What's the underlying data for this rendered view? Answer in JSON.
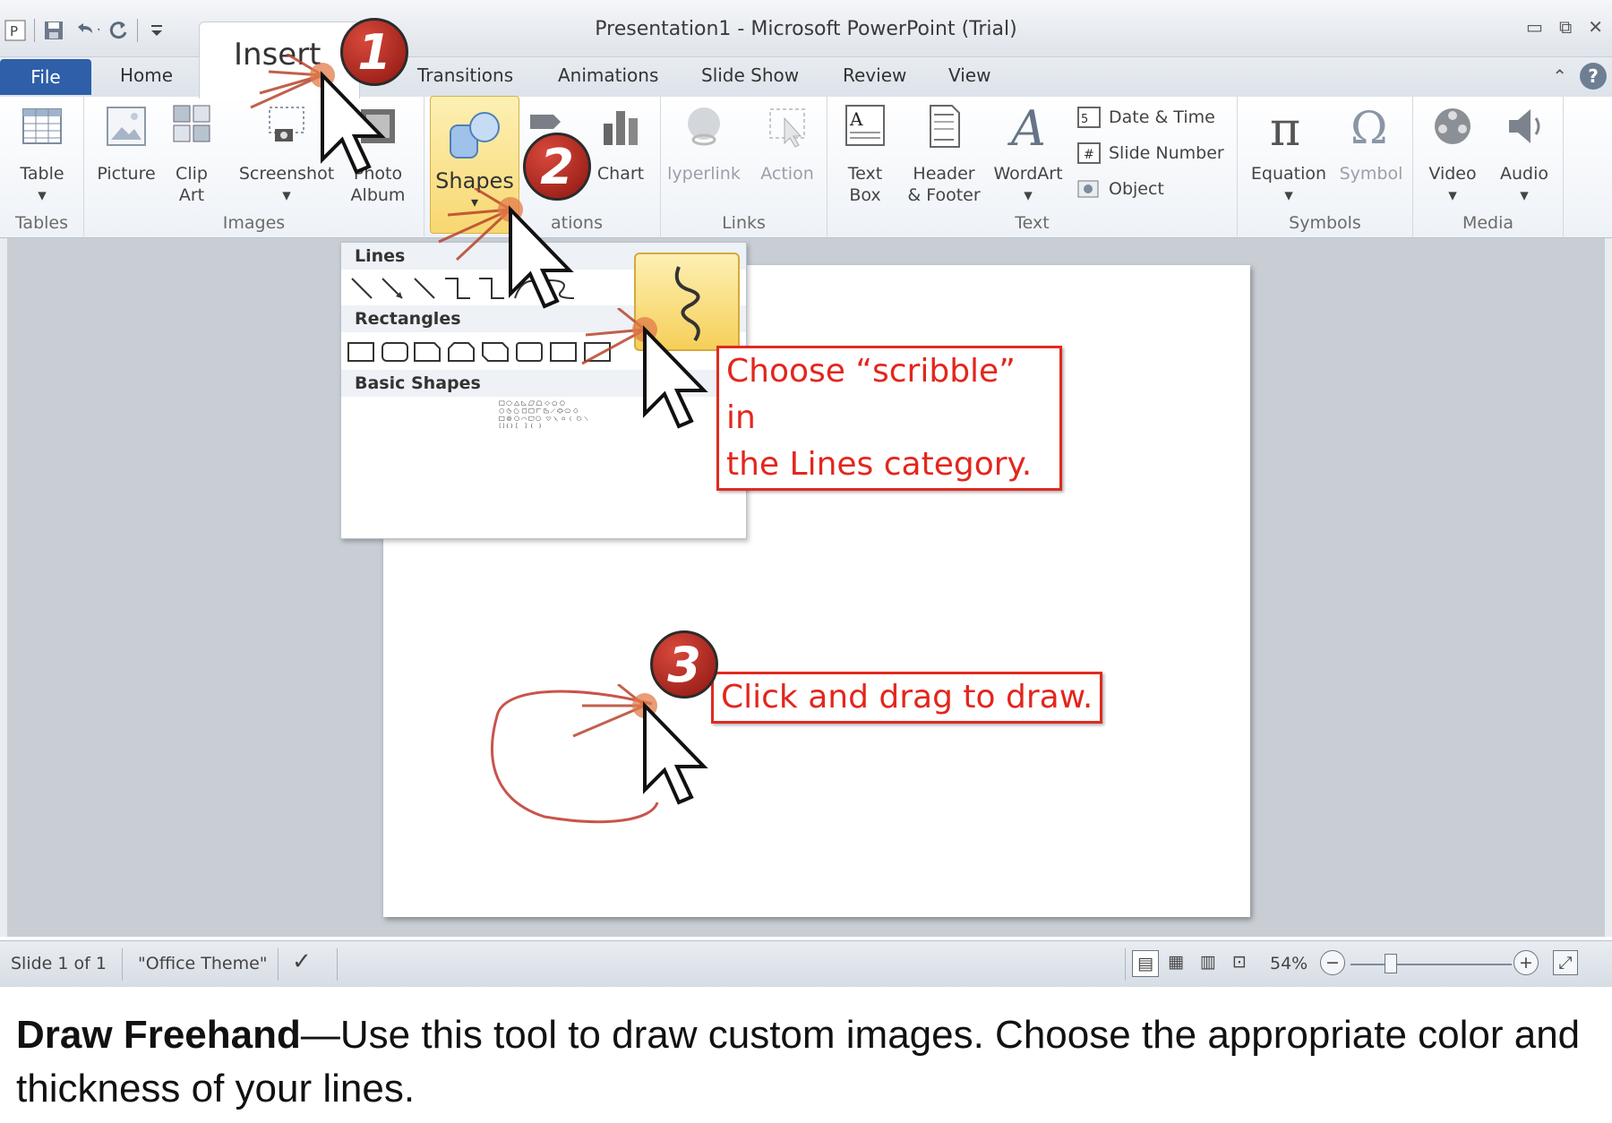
{
  "window": {
    "title": "Presentation1  -  Microsoft PowerPoint (Trial)",
    "controls": [
      "▭",
      "⧉",
      "✕"
    ]
  },
  "qat": {
    "icons": [
      "ppt-logo-icon",
      "save-icon",
      "undo-icon",
      "redo-icon",
      "customize-icon"
    ]
  },
  "tabs": {
    "file": "File",
    "home": "Home",
    "insert": "Insert",
    "transitions": "Transitions",
    "animations": "Animations",
    "slideshow": "Slide Show",
    "review": "Review",
    "view": "View"
  },
  "ribbon": {
    "tables": {
      "label": "Tables",
      "table": "Table"
    },
    "images": {
      "label": "Images",
      "picture": "Picture",
      "clip_line1": "Clip",
      "clip_line2": "Art",
      "screenshot": "Screenshot",
      "photo_line1": "Photo",
      "photo_line2": "Album"
    },
    "illustrations": {
      "label": "ations",
      "shapes": "Shapes",
      "chart": "Chart"
    },
    "links": {
      "label": "Links",
      "hyperlink": "lyperlink",
      "action": "Action"
    },
    "text": {
      "label": "Text",
      "textbox_line1": "Text",
      "textbox_line2": "Box",
      "header_line1": "Header",
      "header_line2": "& Footer",
      "wordart": "WordArt",
      "datetime": "Date & Time",
      "slidenumber": "Slide Number",
      "object": "Object"
    },
    "symbols": {
      "label": "Symbols",
      "equation": "Equation",
      "symbol": "Symbol"
    },
    "media": {
      "label": "Media",
      "video": "Video",
      "audio": "Audio"
    }
  },
  "gallery": {
    "lines": "Lines",
    "rectangles": "Rectangles",
    "basic_shapes": "Basic Shapes"
  },
  "callouts": {
    "step1": "1",
    "step2": "2",
    "step3": "3",
    "scribble_line1": "Choose “scribble” in",
    "scribble_line2": "the Lines category.",
    "draw": "Click and drag to draw."
  },
  "statusbar": {
    "slide": "Slide 1 of 1",
    "theme": "\"Office Theme\"",
    "zoom": "54%"
  },
  "caption": {
    "bold": "Draw Freehand",
    "text": "—Use this tool to draw custom images.  Choose the appropriate color and thickness of your lines."
  },
  "colors": {
    "accent_red": "#e3261d",
    "file_tab": "#2e5fa8",
    "highlight": "#f8d771",
    "freehand_stroke": "#c9544c"
  }
}
